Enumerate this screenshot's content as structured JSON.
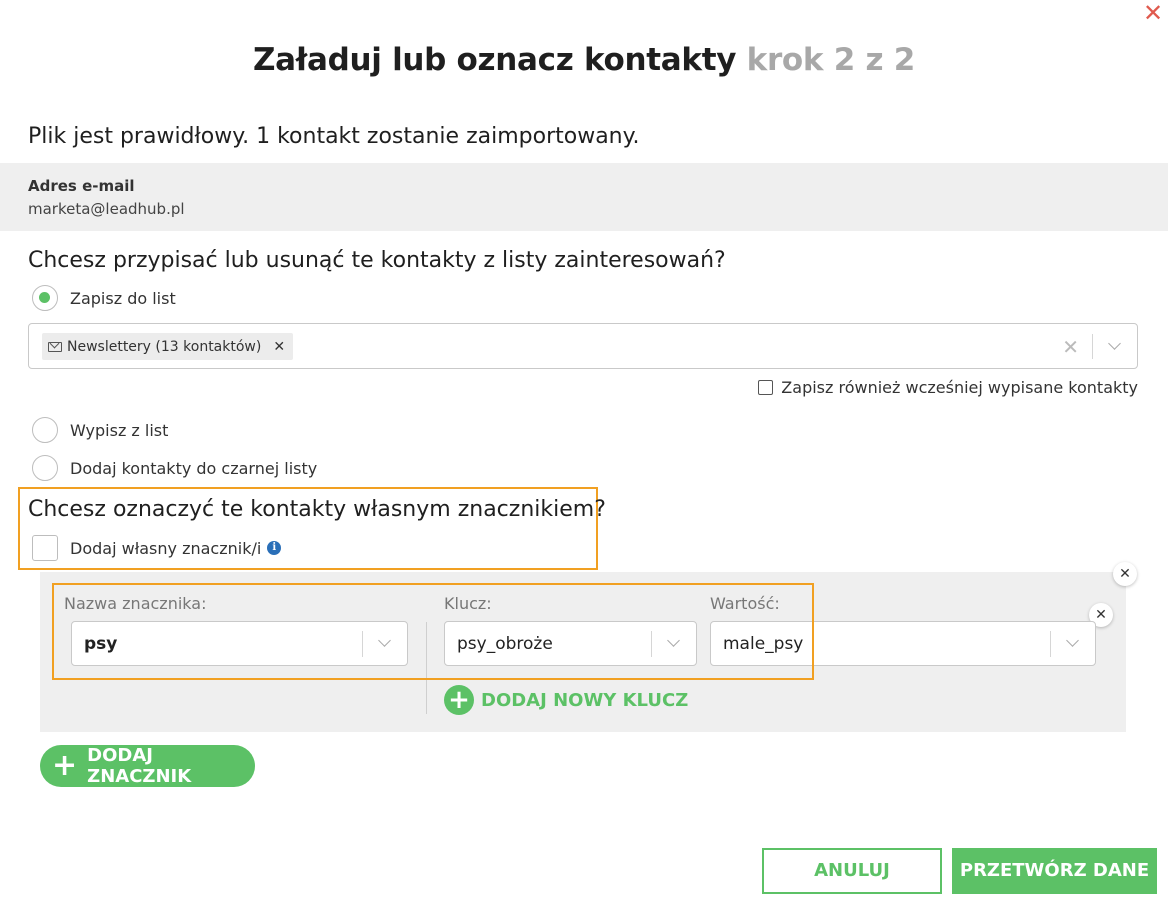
{
  "dialog": {
    "title": "Załaduj lub oznacz kontakty",
    "step": "krok 2 z 2",
    "close_icon": "close-icon"
  },
  "validation": {
    "message": "Plik jest prawidłowy. 1 kontakt zostanie zaimportowany."
  },
  "preview": {
    "column_header": "Adres e-mail",
    "value": "marketa@leadhub.pl"
  },
  "lists": {
    "question": "Chcesz przypisać lub usunąć te kontakty z listy zainteresowań?",
    "options": [
      {
        "label": "Zapisz do list",
        "checked": true
      },
      {
        "label": "Wypisz z list",
        "checked": false
      },
      {
        "label": "Dodaj kontakty do czarnej listy",
        "checked": false
      }
    ],
    "selected_chip": "Newslettery (13 kontaktów)",
    "also_save_label": "Zapisz również wcześniej wypisane kontakty"
  },
  "tags": {
    "question": "Chcesz oznaczyć te kontakty własnym znacznikiem?",
    "checkbox_label": "Dodaj własny znacznik/i",
    "name_label": "Nazwa znacznika:",
    "name_value": "psy",
    "key_label": "Klucz:",
    "key_value": "psy_obroże",
    "value_label": "Wartość:",
    "value_value": "male_psy",
    "add_key_label": "DODAJ NOWY KLUCZ",
    "add_tag_label": "DODAJ ZNACZNIK"
  },
  "footer": {
    "cancel_label": "ANULUJ",
    "process_label": "PRZETWÓRZ DANE"
  },
  "colors": {
    "accent_green": "#5cc166",
    "highlight_orange": "#f1a022",
    "close_red": "#e05a4e"
  }
}
